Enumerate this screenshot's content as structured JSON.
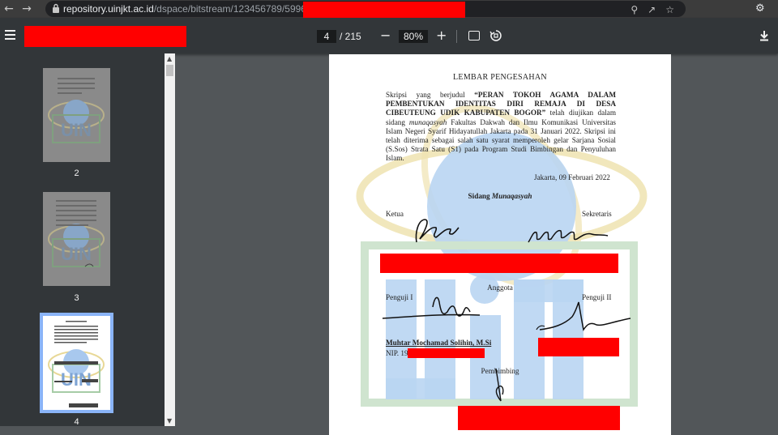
{
  "browser": {
    "url_host": "repository.uinjkt.ac.id",
    "url_path": "/dspace/bitstream/123456789/59961/"
  },
  "toolbar": {
    "current_page": "4",
    "page_total": "/ 215",
    "zoom": "80%",
    "zoom_out": "−",
    "zoom_in": "+"
  },
  "thumbnails": [
    {
      "label": "2"
    },
    {
      "label": "3"
    },
    {
      "label": "4"
    }
  ],
  "document": {
    "title": "LEMBAR PENGESAHAN",
    "para_start": "Skripsi yang berjudul ",
    "thesis_title": "“PERAN TOKOH AGAMA DALAM PEMBENTUKAN IDENTITAS DIRI REMAJA DI DESA CIBEUTEUNG UDIK KABUPATEN BOGOR”",
    "para_mid": " telah diujikan dalam sidang ",
    "munaqasyah_word": "munaqasyah",
    "para_end": " Fakultas Dakwah dan Ilmu Komunikasi Universitas Islam Negeri Syarif Hidayatullah Jakarta pada 31 Januari 2022. Skripsi ini telah diterima sebagai salah satu syarat memperoleh gelar Sarjana Sosial (S.Sos) Strata Satu (S1) pada Program Studi Bimbingan dan Penyuluhan Islam.",
    "date": "Jakarta, 09 Februari 2022",
    "sidang_prefix": "Sidang ",
    "sidang_word": "Munaqasyah",
    "ketua": "Ketua",
    "sekretaris": "Sekretaris",
    "anggota": "Anggota",
    "penguji1": "Penguji I",
    "penguji2": "Penguji II",
    "examiner_name": "Muhtar Mochamad Solihin, M.Si",
    "nip_prefix": "NIP. 19",
    "pembimbing": "Pembimbing"
  },
  "colors": {
    "redaction": "#ff0000",
    "watermark_blue": "#4a86e8",
    "watermark_gold": "#e6d28a",
    "watermark_green": "#8fbf8f"
  },
  "icons": [
    "arrow-left-icon",
    "arrow-right-icon",
    "lock-icon",
    "search-icon",
    "share-icon",
    "star-icon",
    "extension-icon",
    "menu-icon",
    "fit-page-icon",
    "rotate-icon",
    "download-icon"
  ]
}
